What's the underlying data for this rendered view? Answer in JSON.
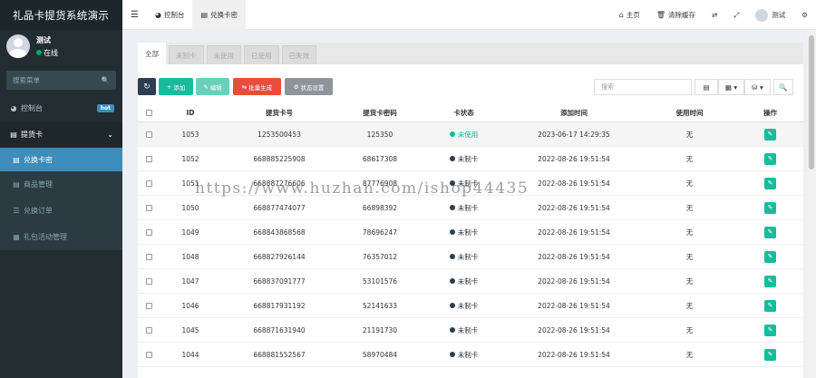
{
  "app": {
    "title": "礼品卡提货系统演示"
  },
  "user": {
    "name": "测试",
    "status": "在线"
  },
  "sidebar": {
    "search_placeholder": "搜索菜单",
    "items": [
      {
        "label": "控制台",
        "icon": "dashboard-icon",
        "badge": "hot"
      },
      {
        "label": "提货卡",
        "icon": "list-icon"
      },
      {
        "label": "兑换卡密",
        "icon": "card-icon"
      },
      {
        "label": "商品管理",
        "icon": "goods-icon"
      },
      {
        "label": "兑换订单",
        "icon": "order-icon"
      },
      {
        "label": "礼包活动管理",
        "icon": "grid-icon"
      }
    ]
  },
  "topbar": {
    "tabs": [
      {
        "label": "控制台"
      },
      {
        "label": "兑换卡密"
      }
    ],
    "home": "主页",
    "clear_cache": "清除缓存",
    "user": "测试"
  },
  "tabs": [
    "全部",
    "未制卡",
    "未使用",
    "已使用",
    "已失效"
  ],
  "toolbar": {
    "add": "添加",
    "edit": "编辑",
    "batch": "批量生成",
    "status": "状态设置",
    "search_placeholder": "搜索"
  },
  "table": {
    "headers": [
      "ID",
      "提货卡号",
      "提货卡密码",
      "卡状态",
      "添加时间",
      "使用时间",
      "操作"
    ],
    "rows": [
      {
        "id": "1053",
        "card": "1253500453",
        "pwd": "125350",
        "status": "未使用",
        "status_color": "#18bc9c",
        "added": "2023-06-17 14:29:35",
        "used": "无"
      },
      {
        "id": "1052",
        "card": "668885225908",
        "pwd": "68617308",
        "status": "未制卡",
        "status_color": "#2c3e50",
        "added": "2022-08-26 19:51:54",
        "used": "无"
      },
      {
        "id": "1051",
        "card": "668887276606",
        "pwd": "87776908",
        "status": "未制卡",
        "status_color": "#2c3e50",
        "added": "2022-08-26 19:51:54",
        "used": "无"
      },
      {
        "id": "1050",
        "card": "668877474077",
        "pwd": "66898392",
        "status": "未制卡",
        "status_color": "#2c3e50",
        "added": "2022-08-26 19:51:54",
        "used": "无"
      },
      {
        "id": "1049",
        "card": "668843868568",
        "pwd": "78696247",
        "status": "未制卡",
        "status_color": "#2c3e50",
        "added": "2022-08-26 19:51:54",
        "used": "无"
      },
      {
        "id": "1048",
        "card": "668827926144",
        "pwd": "76357012",
        "status": "未制卡",
        "status_color": "#2c3e50",
        "added": "2022-08-26 19:51:54",
        "used": "无"
      },
      {
        "id": "1047",
        "card": "668837091777",
        "pwd": "53101576",
        "status": "未制卡",
        "status_color": "#2c3e50",
        "added": "2022-08-26 19:51:54",
        "used": "无"
      },
      {
        "id": "1046",
        "card": "668817931192",
        "pwd": "52141633",
        "status": "未制卡",
        "status_color": "#2c3e50",
        "added": "2022-08-26 19:51:54",
        "used": "无"
      },
      {
        "id": "1045",
        "card": "668871631940",
        "pwd": "21191730",
        "status": "未制卡",
        "status_color": "#2c3e50",
        "added": "2022-08-26 19:51:54",
        "used": "无"
      },
      {
        "id": "1044",
        "card": "668881552567",
        "pwd": "58970484",
        "status": "未制卡",
        "status_color": "#2c3e50",
        "added": "2022-08-26 19:51:54",
        "used": "无"
      }
    ]
  },
  "watermark": "https://www.huzhan.com/ishop44435"
}
